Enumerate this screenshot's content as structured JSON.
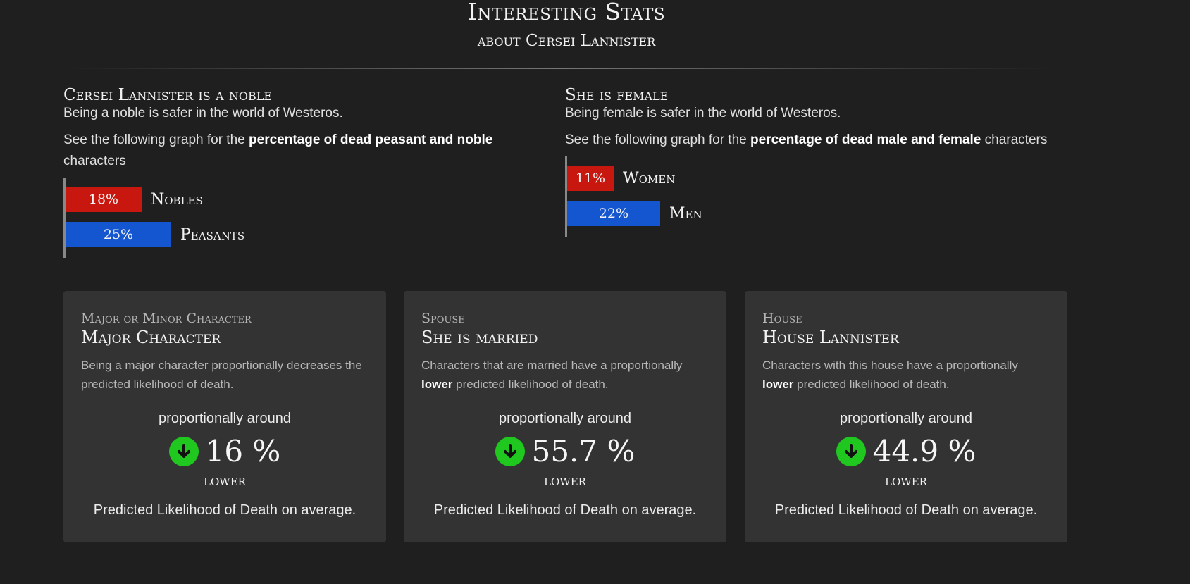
{
  "header": {
    "title": "Interesting Stats",
    "subtitle": "about Cersei Lannister"
  },
  "stats": {
    "left": {
      "heading": "Cersei Lannister is a noble",
      "line": "Being a noble is safer in the world of Westeros.",
      "desc_prefix": "See the following graph for the ",
      "desc_bold": "percentage of dead peasant and noble",
      "desc_suffix": " characters",
      "bars": [
        {
          "label": "Nobles",
          "value_text": "18%",
          "value": 18,
          "color": "#c8170f"
        },
        {
          "label": "Peasants",
          "value_text": "25%",
          "value": 25,
          "color": "#1356d0"
        }
      ]
    },
    "right": {
      "heading": "She is female",
      "line": "Being female is safer in the world of Westeros.",
      "desc_prefix": "See the following graph for the ",
      "desc_bold": "percentage of dead male and female",
      "desc_suffix": " characters",
      "bars": [
        {
          "label": "Women",
          "value_text": "11%",
          "value": 11,
          "color": "#c8170f"
        },
        {
          "label": "Men",
          "value_text": "22%",
          "value": 22,
          "color": "#1356d0"
        }
      ]
    }
  },
  "cards": [
    {
      "category": "Major or Minor Character",
      "title": "Major Character",
      "desc_plain": "Being a major character proportionally decreases the predicted likelihood of death.",
      "desc_prefix": "",
      "desc_bold": "",
      "desc_suffix": "",
      "around": "proportionally around",
      "value": "16 %",
      "direction": "lower",
      "footer": "Predicted Likelihood of Death on average."
    },
    {
      "category": "Spouse",
      "title": "She is married",
      "desc_plain": "",
      "desc_prefix": "Characters that are married have a proportionally ",
      "desc_bold": "lower",
      "desc_suffix": " predicted likelihood of death.",
      "around": "proportionally around",
      "value": "55.7 %",
      "direction": "lower",
      "footer": "Predicted Likelihood of Death on average."
    },
    {
      "category": "House",
      "title": "House Lannister",
      "desc_plain": "",
      "desc_prefix": "Characters with this house have a proportionally ",
      "desc_bold": "lower",
      "desc_suffix": " predicted likelihood of death.",
      "around": "proportionally around",
      "value": "44.9 %",
      "direction": "lower",
      "footer": "Predicted Likelihood of Death on average."
    }
  ],
  "icons": {
    "card_arrow": "arrow-down-circle-icon",
    "arrow_color": "#1fc71f"
  }
}
